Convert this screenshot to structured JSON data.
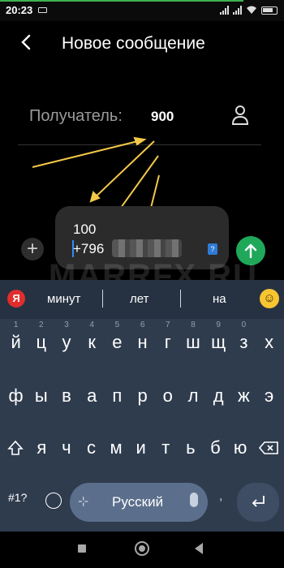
{
  "status_bar": {
    "time": "20:23",
    "accent_color": "#3fb24f"
  },
  "header": {
    "back_icon": "chevron-left-icon",
    "title": "Новое сообщение"
  },
  "recipient": {
    "label": "Получатель:",
    "value": "900",
    "contact_icon": "person-icon"
  },
  "compose": {
    "line1": "100",
    "line2_prefix": "+796",
    "sim_badge": "?",
    "attach_icon": "plus-icon",
    "send_icon": "arrow-up-icon",
    "send_color": "#1fa85a"
  },
  "watermark": "MARRFX.RU",
  "keyboard": {
    "suggestions": [
      "минут",
      "лет",
      "на"
    ],
    "row1": [
      "й",
      "ц",
      "у",
      "к",
      "е",
      "н",
      "г",
      "ш",
      "щ",
      "з",
      "х"
    ],
    "row1_hints": [
      "1",
      "2",
      "3",
      "4",
      "5",
      "6",
      "7",
      "8",
      "9",
      "0",
      ""
    ],
    "row2": [
      "ф",
      "ы",
      "в",
      "а",
      "п",
      "р",
      "о",
      "л",
      "д",
      "ж",
      "э"
    ],
    "row3": [
      "я",
      "ч",
      "с",
      "м",
      "и",
      "т",
      "ь",
      "б",
      "ю"
    ],
    "symbols_label": "#1?",
    "space_label": "Русский",
    "brand_color": "#e12d2d",
    "background_color": "#2f3c4e"
  }
}
